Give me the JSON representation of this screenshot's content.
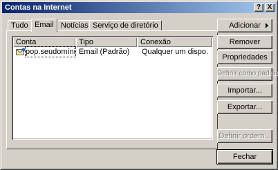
{
  "window": {
    "title": "Contas na Internet"
  },
  "titlebar_buttons": {
    "help": "?",
    "close": "X"
  },
  "tabs": [
    {
      "label": "Tudo"
    },
    {
      "label": "Email",
      "active": true
    },
    {
      "label": "Notícias"
    },
    {
      "label": "Serviço de diretório"
    }
  ],
  "list": {
    "columns": [
      "Conta",
      "Tipo",
      "Conexão"
    ],
    "rows": [
      {
        "conta": "pop.seudomínio....",
        "tipo": "Email (Padrão)",
        "conexao": "Qualquer um dispo..."
      }
    ]
  },
  "buttons": {
    "adicionar": "Adicionar",
    "remover": "Remover",
    "propriedades": "Propriedades",
    "definir_padrao": "Definir como padrão",
    "importar": "Importar...",
    "exportar": "Exportar...",
    "definir_ordem": "Definir ordem...",
    "fechar": "Fechar"
  }
}
